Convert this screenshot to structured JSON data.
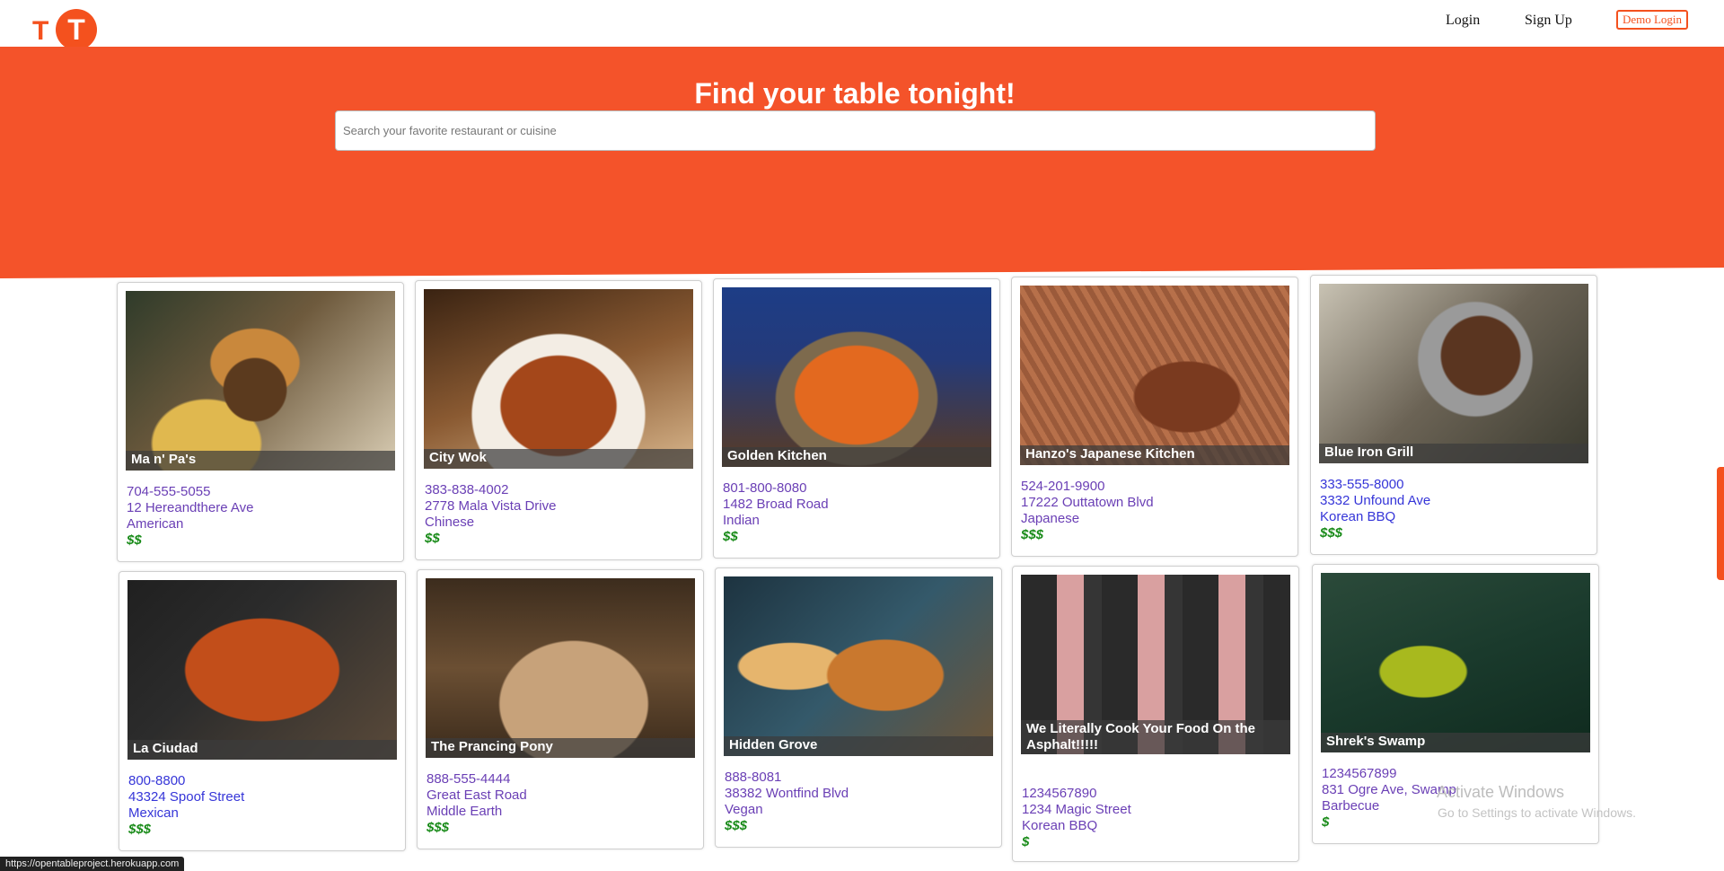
{
  "nav": {
    "logo_small": "T",
    "logo_circle": "T",
    "login": "Login",
    "signup": "Sign Up",
    "demo_login": "Demo Login"
  },
  "hero": {
    "title": "Find your table tonight!",
    "search_placeholder": "Search your favorite restaurant or cuisine"
  },
  "colors": {
    "brand": "#f4532a",
    "link_purple": "#6a3fb5",
    "link_blue": "#3535d8",
    "price_green": "#178a17"
  },
  "restaurants": [
    {
      "name": "Ma n' Pa's",
      "phone": "704-555-5055",
      "address": "12 Hereandthere Ave",
      "cuisine": "American",
      "price": "$$",
      "image": "burger-fries"
    },
    {
      "name": "City Wok",
      "phone": "383-838-4002",
      "address": "2778 Mala Vista Drive",
      "cuisine": "Chinese",
      "price": "$$",
      "image": "orange-chicken"
    },
    {
      "name": "Golden Kitchen",
      "phone": "801-800-8080",
      "address": "1482 Broad Road",
      "cuisine": "Indian",
      "price": "$$",
      "image": "curry-pot"
    },
    {
      "name": "Hanzo's Japanese Kitchen",
      "phone": "524-201-9900",
      "address": "17222 Outtatown Blvd",
      "cuisine": "Japanese",
      "price": "$$$",
      "image": "unagi-box"
    },
    {
      "name": "Blue Iron Grill",
      "phone": "333-555-8000",
      "address": "3332 Unfound Ave",
      "cuisine": "Korean BBQ",
      "price": "$$$",
      "image": "korean-grill"
    },
    {
      "name": "La Ciudad",
      "phone": "800-8800",
      "address": "43324 Spoof Street",
      "cuisine": "Mexican",
      "price": "$$$",
      "image": "birria-tacos"
    },
    {
      "name": "The Prancing Pony",
      "phone": "888-555-4444",
      "address": "Great East Road",
      "cuisine": "Middle Earth",
      "price": "$$$",
      "image": "feast-table"
    },
    {
      "name": "Hidden Grove",
      "phone": "888-8081",
      "address": "38382 Wontfind Blvd",
      "cuisine": "Vegan",
      "price": "$$$",
      "image": "vegan-burger"
    },
    {
      "name": "We Literally Cook Your Food On the Asphalt!!!!!",
      "phone": "1234567890",
      "address": "1234 Magic Street",
      "cuisine": "Korean BBQ",
      "price": "$",
      "image": "bbq-spread"
    },
    {
      "name": "Shrek's Swamp",
      "phone": "1234567899",
      "address": "831 Ogre Ave, Swamp",
      "cuisine": "Barbecue",
      "price": "$",
      "image": "swamp-ogre"
    }
  ],
  "watermark": {
    "title": "Activate Windows",
    "subtitle": "Go to Settings to activate Windows."
  },
  "status_url": "https://opentableproject.herokuapp.com"
}
